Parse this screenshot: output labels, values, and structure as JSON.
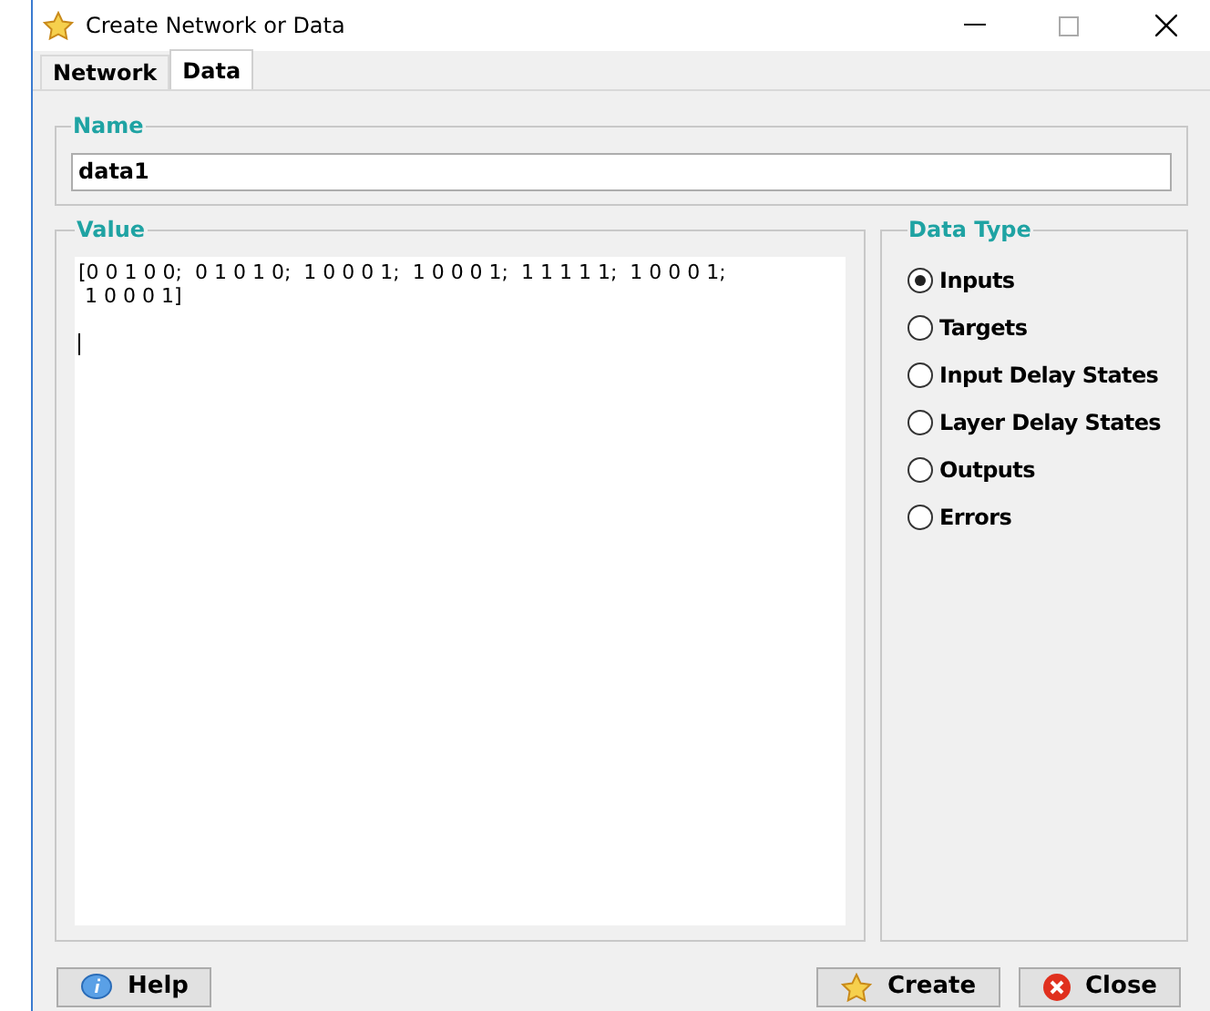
{
  "window": {
    "title": "Create Network or Data"
  },
  "tabs": [
    {
      "label": "Network",
      "selected": false
    },
    {
      "label": "Data",
      "selected": true
    }
  ],
  "name": {
    "legend": "Name",
    "value": "data1"
  },
  "value": {
    "legend": "Value",
    "text": "[0 0 1 0 0;  0 1 0 1 0;  1 0 0 0 1;  1 0 0 0 1;  1 1 1 1 1;  1 0 0 0 1;\n 1 0 0 0 1]"
  },
  "data_type": {
    "legend": "Data Type",
    "options": [
      {
        "label": "Inputs",
        "selected": true
      },
      {
        "label": "Targets",
        "selected": false
      },
      {
        "label": "Input Delay States",
        "selected": false
      },
      {
        "label": "Layer Delay States",
        "selected": false
      },
      {
        "label": "Outputs",
        "selected": false
      },
      {
        "label": "Errors",
        "selected": false
      }
    ]
  },
  "buttons": [
    {
      "kind": "help",
      "label": "Help"
    },
    {
      "kind": "create",
      "label": "Create"
    },
    {
      "kind": "close",
      "label": "Close"
    }
  ]
}
